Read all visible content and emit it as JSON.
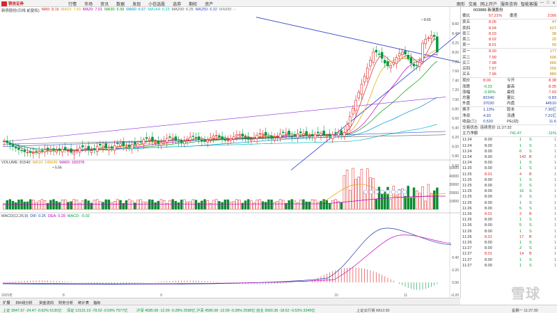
{
  "app": {
    "name": "银信证券"
  },
  "menu": [
    "行情",
    "市场",
    "资讯",
    "数据",
    "发现",
    "小信选股",
    "选券",
    "期权",
    "资产"
  ],
  "topright": [
    "图形",
    "交易",
    "网上开户",
    "服务咨询",
    "智能客服"
  ],
  "window_controls": [
    "—",
    "□",
    "✕"
  ],
  "legend_price": {
    "name": "新债股份(日线 前复权)",
    "items": [
      {
        "text": "MA5: 8.16",
        "color": "#d8262c"
      },
      {
        "text": "MA10: 7.69",
        "color": "#e0a000"
      },
      {
        "text": "MA20: 7.01",
        "color": "#c000c0"
      },
      {
        "text": "MA30: 6.99",
        "color": "#00a000"
      },
      {
        "text": "MA60: 6.67",
        "color": "#0090d0"
      },
      {
        "text": "MA144: 6.33",
        "color": "#00c0c0"
      },
      {
        "text": "MA200: 6.25",
        "color": "#606060"
      },
      {
        "text": "MA250: 6.32",
        "color": "#3050d0"
      },
      {
        "text": "MA888: --",
        "color": "#888888"
      }
    ]
  },
  "legend_volume": [
    {
      "text": "VOLUME: 81540",
      "color": "#444444"
    },
    {
      "text": "MA10: 145649",
      "color": "#e0a000"
    },
    {
      "text": "MA60: 183378",
      "color": "#c000c0"
    }
  ],
  "legend_macd": [
    {
      "text": "MACD(12,26,9)",
      "color": "#444444"
    },
    {
      "text": "DIF: 0.25",
      "color": "#1e3ea8"
    },
    {
      "text": "DEA: 0.28",
      "color": "#c000c0"
    },
    {
      "text": "MACD: -0.02",
      "color": "#009a3c"
    }
  ],
  "chart_annotations": {
    "high": "8.69",
    "low": "5.56"
  },
  "price_axis": [
    "8.60",
    "8.40",
    "8.20",
    "8.00",
    "7.80",
    "7.60",
    "7.40",
    "7.20",
    "7.00",
    "6.80",
    "6.60",
    "6.40",
    "6.20",
    "6.00",
    "5.80",
    "5.60"
  ],
  "volume_axis": [
    "50000",
    "40000",
    "30000",
    "20000",
    "10000"
  ],
  "macd_axis": [
    "0.40",
    "0.20",
    "0.00",
    "-0.20"
  ],
  "date_labels": [
    "2025年",
    "8",
    "9",
    "10",
    "11"
  ],
  "quote": {
    "code_name": "603889 新澳股份",
    "weibi_label": "委比",
    "weibi_value": "57.21%",
    "weicha_label": "委差",
    "weicha_value": "2166",
    "asks": [
      {
        "label": "卖五",
        "price": "8.05",
        "vol": "47"
      },
      {
        "label": "卖四",
        "price": "8.04",
        "vol": "627"
      },
      {
        "label": "卖三",
        "price": "8.03",
        "vol": "38"
      },
      {
        "label": "卖二",
        "price": "8.02",
        "vol": "25"
      },
      {
        "label": "卖一",
        "price": "8.01",
        "vol": "99"
      }
    ],
    "bids": [
      {
        "label": "买一",
        "price": "8.00",
        "vol": "177"
      },
      {
        "label": "买二",
        "price": "7.99",
        "vol": "506"
      },
      {
        "label": "买三",
        "price": "7.98",
        "vol": "666"
      },
      {
        "label": "买四",
        "price": "7.97",
        "vol": "256"
      },
      {
        "label": "买五",
        "price": "7.96",
        "vol": "880"
      }
    ],
    "stats": [
      {
        "l1": "现价",
        "v1": "8.00",
        "l2": "今开",
        "v2": "8.38"
      },
      {
        "l1": "涨跌",
        "v1": "-0.33",
        "l2": "最高",
        "v2": "8.35"
      },
      {
        "l1": "涨幅",
        "v1": "-3.96%",
        "l2": "最低",
        "v2": "7.93"
      },
      {
        "l1": "总量",
        "v1": "81540",
        "l2": "量比",
        "v2": "0.83"
      },
      {
        "l1": "外盘",
        "v1": "37030",
        "l2": "内盘",
        "v2": "44510"
      },
      {
        "l1": "换手",
        "v1": "1.13%",
        "l2": "股本",
        "v2": "7.30亿"
      },
      {
        "l1": "净资",
        "v1": "4.93",
        "l2": "流通",
        "v2": "7.21亿"
      },
      {
        "l1": "收益(三)",
        "v1": "0.520",
        "l2": "PE(动)",
        "v2": "11.6"
      }
    ],
    "trade_status": "交易状态: 连续竞价 11:27:32",
    "main_flow_label": "主力净额",
    "main_flow_value": "-741.47",
    "main_flow_pct": "-11%"
  },
  "ticks": [
    {
      "time": "11:24",
      "price": "8.00",
      "vol": "1",
      "dir": "S"
    },
    {
      "time": "11:24",
      "price": "8.00",
      "vol": "1",
      "dir": "S"
    },
    {
      "time": "11:24",
      "price": "8.00",
      "vol": "6",
      "dir": "S"
    },
    {
      "time": "11:24",
      "price": "8.00",
      "vol": "143",
      "dir": "B"
    },
    {
      "time": "11:24",
      "price": "8.00",
      "vol": "1",
      "dir": "S"
    },
    {
      "time": "11:25",
      "price": "8.00",
      "vol": "1",
      "dir": "S"
    },
    {
      "time": "11:25",
      "price": "8.01",
      "vol": "4",
      "dir": "B"
    },
    {
      "time": "11:25",
      "price": "8.00",
      "vol": "1",
      "dir": "S"
    },
    {
      "time": "11:25",
      "price": "8.00",
      "vol": "2",
      "dir": "S"
    },
    {
      "time": "11:25",
      "price": "8.00",
      "vol": "16",
      "dir": "S"
    },
    {
      "time": "11:25",
      "price": "8.00",
      "vol": "3",
      "dir": "S"
    },
    {
      "time": "11:26",
      "price": "8.00",
      "vol": "1",
      "dir": "S"
    },
    {
      "time": "11:26",
      "price": "8.00",
      "vol": "5",
      "dir": "S"
    },
    {
      "time": "11:26",
      "price": "8.01",
      "vol": "2",
      "dir": "B"
    },
    {
      "time": "11:26",
      "price": "8.00",
      "vol": "1",
      "dir": "S"
    },
    {
      "time": "11:26",
      "price": "8.00",
      "vol": "5",
      "dir": "S"
    },
    {
      "time": "11:26",
      "price": "8.00",
      "vol": "1",
      "dir": "S"
    },
    {
      "time": "11:26",
      "price": "8.01",
      "vol": "17",
      "dir": "B"
    },
    {
      "time": "11:26",
      "price": "8.00",
      "vol": "1",
      "dir": "S"
    },
    {
      "time": "11:27",
      "price": "8.00",
      "vol": "2",
      "dir": "S"
    },
    {
      "time": "11:27",
      "price": "8.01",
      "vol": "14",
      "dir": "B"
    },
    {
      "time": "11:27",
      "price": "8.00",
      "vol": "1",
      "dir": "S"
    },
    {
      "time": "11:27",
      "price": "8.00",
      "vol": "1",
      "dir": "S"
    }
  ],
  "bottom_tabs": [
    "扩展",
    "日K线分析",
    "资金流向",
    "财务分析",
    "统计表",
    "指标"
  ],
  "status_bar": [
    {
      "text": "上证 3947.57  -24.47  -0.62%  5135亿",
      "color": "#009a3c"
    },
    {
      "text": "深证 13131.19 -78.02  -0.59%  7577亿",
      "color": "#009a3c"
    },
    {
      "text": "沪深 4585.08  -12.99  -0.28%  2598亿",
      "color": "#009a3c"
    },
    {
      "text": "沪深 4585.08  -12.99  -0.28%  2598亿",
      "color": "#009a3c"
    },
    {
      "text": "创业 3060.38  -18.62  -0.53%  3349亿",
      "color": "#009a3c"
    },
    {
      "text": "上证云行情 Wi12:30",
      "color": "#444444"
    },
    {
      "text": "星期一  11:27:30",
      "color": "#444444"
    }
  ],
  "watermark": "雪球"
}
